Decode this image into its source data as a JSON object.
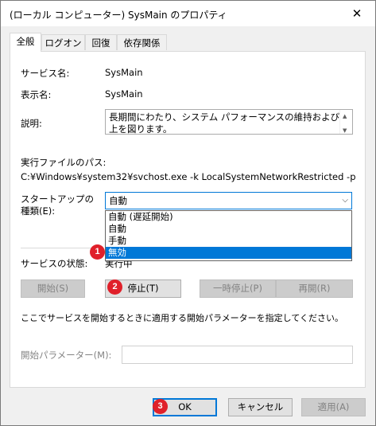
{
  "window": {
    "title": "(ローカル コンピューター) SysMain のプロパティ",
    "close_icon": "close-icon"
  },
  "tabs": [
    {
      "label": "全般",
      "active": true
    },
    {
      "label": "ログオン",
      "active": false
    },
    {
      "label": "回復",
      "active": false
    },
    {
      "label": "依存関係",
      "active": false
    }
  ],
  "general": {
    "service_name_label": "サービス名:",
    "service_name_value": "SysMain",
    "display_name_label": "表示名:",
    "display_name_value": "SysMain",
    "description_label": "説明:",
    "description_value": "長期間にわたり、システム パフォーマンスの維持および向上を図ります。",
    "exe_path_label": "実行ファイルのパス:",
    "exe_path_value": "C:¥Windows¥system32¥svchost.exe -k LocalSystemNetworkRestricted -p",
    "startup_type_label_line1": "スタートアップの",
    "startup_type_label_line2": "種類(E):",
    "startup_type_selected": "自動",
    "startup_type_options": [
      {
        "label": "自動 (遅延開始)",
        "selected": false
      },
      {
        "label": "自動",
        "selected": false
      },
      {
        "label": "手動",
        "selected": false
      },
      {
        "label": "無効",
        "selected": true
      }
    ],
    "service_status_label": "サービスの状態:",
    "service_status_value": "実行中",
    "start_button": "開始(S)",
    "stop_button": "停止(T)",
    "pause_button": "一時停止(P)",
    "resume_button": "再開(R)",
    "start_params_hint": "ここでサービスを開始するときに適用する開始パラメーターを指定してください。",
    "start_params_label": "開始パラメーター(M):",
    "start_params_value": ""
  },
  "footer": {
    "ok_button": "OK",
    "cancel_button": "キャンセル",
    "apply_button": "適用(A)"
  },
  "annotations": {
    "badge1": "1",
    "badge2": "2",
    "badge3": "3",
    "badge_color": "#e0202a"
  },
  "colors": {
    "accent": "#0078d7",
    "selection_text": "#ffffff"
  }
}
